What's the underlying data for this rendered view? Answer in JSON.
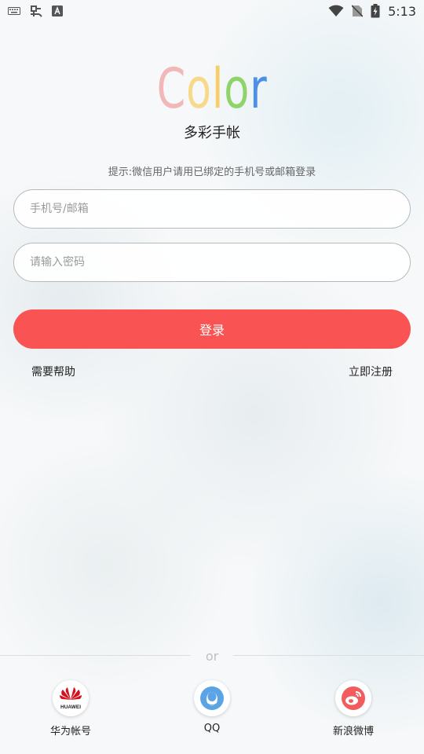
{
  "status_bar": {
    "time": "5:13"
  },
  "app": {
    "logo_letters": [
      "C",
      "o",
      "l",
      "o",
      "r"
    ],
    "logo_colors": [
      "#f2b7b7",
      "#f7d98b",
      "#f7ce6a",
      "#8fd36b",
      "#4a90e6"
    ],
    "subtitle": "多彩手帐",
    "hint": "提示:微信用户请用已绑定的手机号或邮箱登录"
  },
  "form": {
    "phone_placeholder": "手机号/邮箱",
    "phone_value": "",
    "password_placeholder": "请输入密码",
    "password_value": "",
    "login_label": "登录",
    "login_color": "#f95353"
  },
  "links": {
    "help": "需要帮助",
    "register": "立即注册"
  },
  "divider": {
    "text": "or"
  },
  "social": [
    {
      "label": "华为帐号",
      "icon": "huawei-icon",
      "badge": "HUAWEI"
    },
    {
      "label": "QQ",
      "icon": "qq-icon"
    },
    {
      "label": "新浪微博",
      "icon": "weibo-icon"
    }
  ]
}
